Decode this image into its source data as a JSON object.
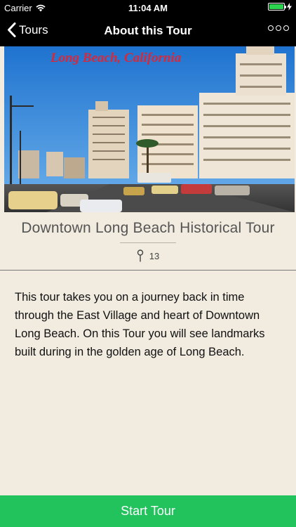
{
  "status_bar": {
    "carrier": "Carrier",
    "time": "11:04 AM",
    "battery_level": 1.0,
    "battery_color": "#2bd34f"
  },
  "nav": {
    "back_label": "Tours",
    "title": "About this Tour",
    "back_icon": "chevron-left-icon",
    "more_icon": "more-options-icon"
  },
  "hero": {
    "caption": "Long Beach, California"
  },
  "tour": {
    "title": "Downtown Long Beach Historical Tour",
    "stop_count": "13",
    "stop_icon": "map-pin-icon",
    "description": "This tour takes you on a journey back in time through the East Village and heart of Downtown Long Beach.  On this Tour you will see landmarks built during in the golden age of Long Beach."
  },
  "actions": {
    "start_label": "Start Tour",
    "start_color": "#22c25d"
  }
}
